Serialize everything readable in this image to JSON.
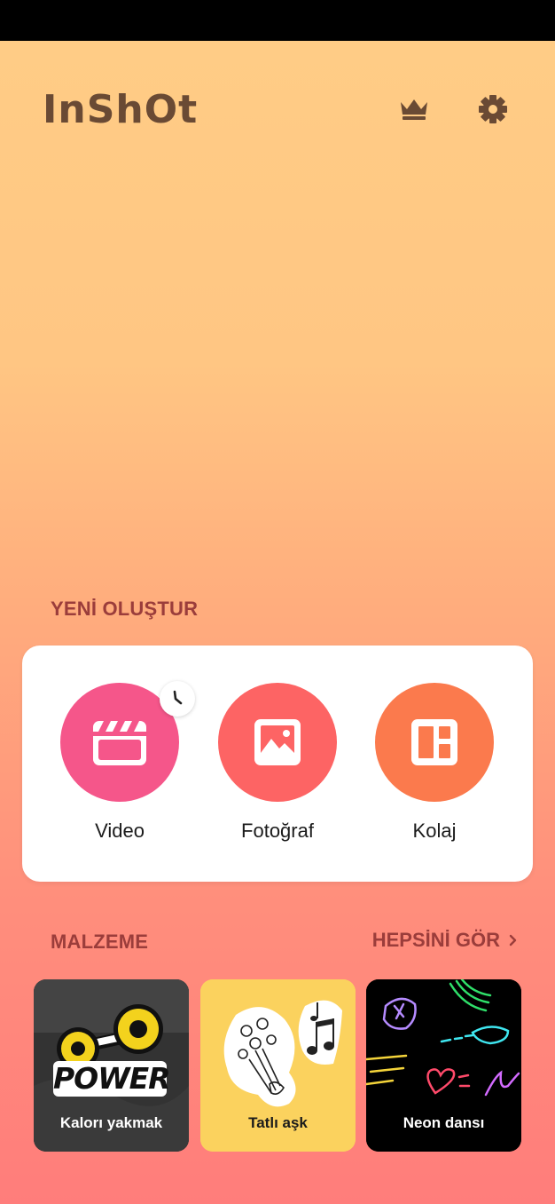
{
  "header": {
    "logo_text": "InShOt",
    "premium_icon": "crown-icon",
    "settings_icon": "gear-icon"
  },
  "create": {
    "title": "YENİ OLUŞTUR",
    "items": [
      {
        "label": "Video",
        "icon": "clapperboard-icon",
        "color": "#f5568a"
      },
      {
        "label": "Fotoğraf",
        "icon": "image-icon",
        "color": "#fd6464"
      },
      {
        "label": "Kolaj",
        "icon": "collage-icon",
        "color": "#fb7a4d"
      }
    ],
    "recent_badge_icon": "clock-icon"
  },
  "materials": {
    "title": "MALZEME",
    "see_all": "HEPSİNİ GÖR",
    "items": [
      {
        "label": "Kalorı yakmak",
        "sticker_text": "POWER"
      },
      {
        "label": "Tatlı aşk"
      },
      {
        "label": "Neon dansı"
      }
    ]
  },
  "colors": {
    "accent_text": "#9b3d3b",
    "logo": "#6a4a34",
    "bg_top": "#ffcd86",
    "bg_bottom": "#ff7d7b"
  }
}
